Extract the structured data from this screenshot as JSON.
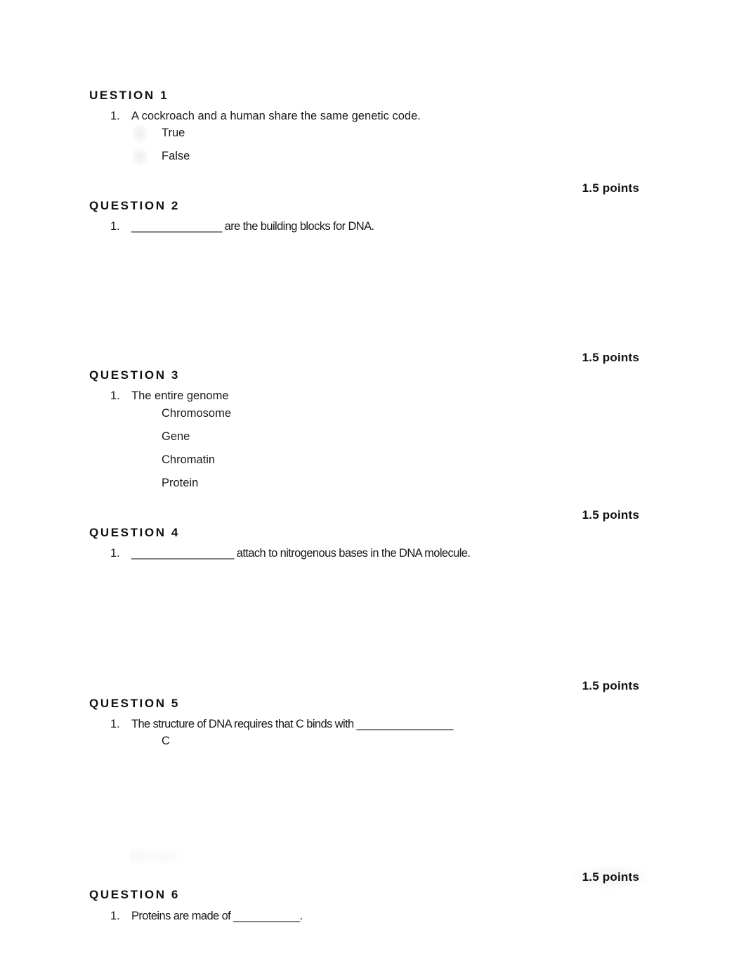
{
  "document": {
    "page_background": "#ffffff",
    "text_color": "#1a1a1a"
  },
  "questions": [
    {
      "header": "UESTION 1",
      "number_label": "1.",
      "stem": "A cockroach and a human share the same genetic code.",
      "choices": [
        "True",
        "False"
      ],
      "points": "1.5 points"
    },
    {
      "header": "QUESTION 2",
      "number_label": "1.",
      "stem": "_______________ are the building blocks for DNA.",
      "choices": [],
      "points": "1.5 points"
    },
    {
      "header": "QUESTION 3",
      "number_label": "1.",
      "stem": "The entire genome",
      "choices": [
        "Chromosome",
        "Gene",
        "Chromatin",
        "Protein"
      ],
      "points": "1.5 points"
    },
    {
      "header": "QUESTION 4",
      "number_label": "1.",
      "stem": "_________________ attach to nitrogenous bases in the DNA molecule.",
      "choices": [],
      "points": "1.5 points"
    },
    {
      "header": "QUESTION 5",
      "number_label": "1.",
      "stem": "The structure of DNA requires that C binds with ________________",
      "choices": [
        "C"
      ],
      "points": "1.5 points"
    },
    {
      "header": "QUESTION 6",
      "number_label": "1.",
      "stem": "Proteins are made of ___________.",
      "choices": [],
      "points": "1.5 points"
    }
  ]
}
